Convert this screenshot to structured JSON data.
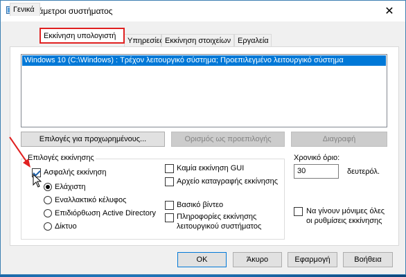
{
  "window": {
    "title": "Παράμετροι συστήματος",
    "close_symbol": "✕"
  },
  "tabs": [
    {
      "label": "Γενικά"
    },
    {
      "label": "Εκκίνηση υπολογιστή"
    },
    {
      "label": "Υπηρεσίες"
    },
    {
      "label": "Εκκίνηση στοιχείων"
    },
    {
      "label": "Εργαλεία"
    }
  ],
  "boot_list": {
    "entries": [
      "Windows 10 (C:\\Windows) : Τρέχον λειτουργικό σύστημα; Προεπιλεγμένο λειτουργικό σύστημα"
    ]
  },
  "actions": {
    "advanced": "Επιλογές για προχωρημένους...",
    "set_default": "Ορισμός ως προεπιλογής",
    "delete": "Διαγραφή"
  },
  "boot_options": {
    "group_label": "Επιλογές εκκίνησης",
    "safe_boot": {
      "label": "Ασφαλής εκκίνηση",
      "checked": true
    },
    "radios": [
      {
        "label": "Ελάχιστη",
        "checked": true
      },
      {
        "label": "Εναλλακτικό κέλυφος",
        "checked": false
      },
      {
        "label": "Επιδιόρθωση Active Directory",
        "checked": false
      },
      {
        "label": "Δίκτυο",
        "checked": false
      }
    ],
    "no_gui": {
      "label": "Καμία εκκίνηση GUI",
      "checked": false
    },
    "boot_log": {
      "label": "Αρχείο καταγραφής εκκίνησης",
      "checked": false
    },
    "base_video": {
      "label": "Βασικό βίντεο",
      "checked": false
    },
    "os_info": {
      "label_line1": "Πληροφορίες εκκίνησης",
      "label_line2": "λειτουργικού συστήματος",
      "checked": false
    }
  },
  "timeout": {
    "label": "Χρονικό όριο:",
    "value": "30",
    "unit": "δευτερόλ."
  },
  "permanent": {
    "label_line1": "Να γίνουν μόνιμες όλες",
    "label_line2": "οι ρυθμίσεις εκκίνησης",
    "checked": false
  },
  "footer": {
    "ok": "OK",
    "cancel": "Άκυρο",
    "apply": "Εφαρμογή",
    "help": "Βοήθεια"
  },
  "colors": {
    "accent": "#0078d7",
    "highlight_box": "#e02020"
  }
}
